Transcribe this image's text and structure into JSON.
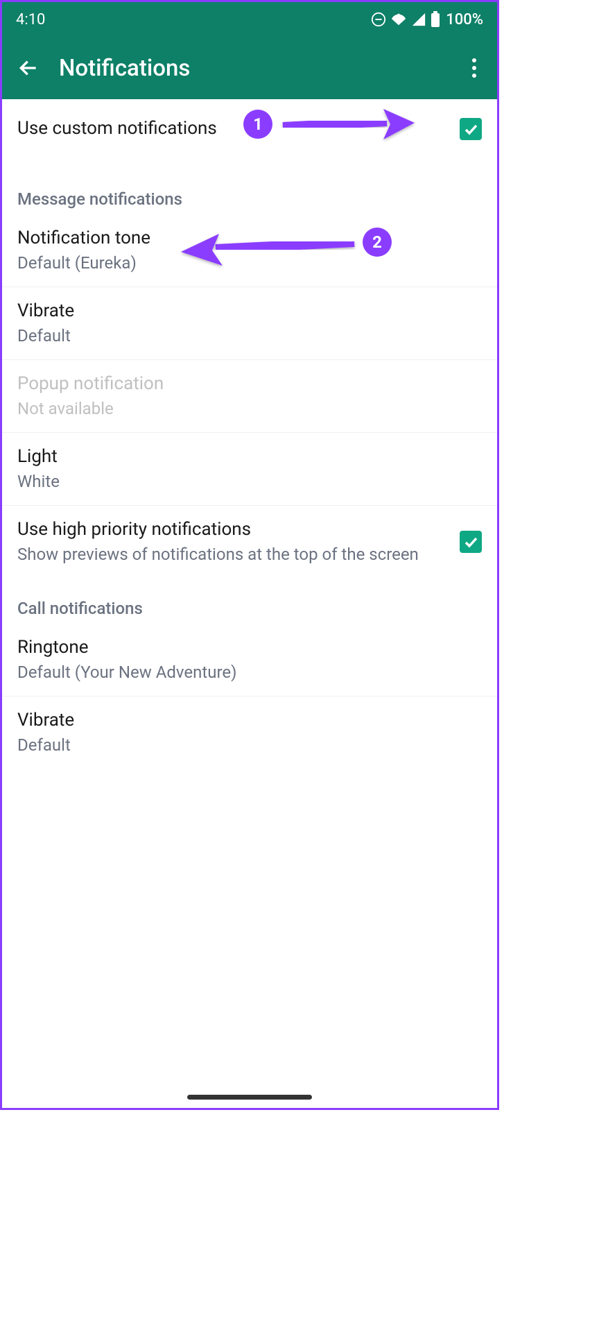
{
  "statusBar": {
    "time": "4:10",
    "batteryPercent": "100%"
  },
  "appBar": {
    "title": "Notifications"
  },
  "settings": {
    "customNotifications": {
      "label": "Use custom notifications",
      "checked": true
    },
    "sections": {
      "message": {
        "header": "Message notifications",
        "notificationTone": {
          "label": "Notification tone",
          "value": "Default (Eureka)"
        },
        "vibrate": {
          "label": "Vibrate",
          "value": "Default"
        },
        "popup": {
          "label": "Popup notification",
          "value": "Not available",
          "disabled": true
        },
        "light": {
          "label": "Light",
          "value": "White"
        },
        "highPriority": {
          "label": "Use high priority notifications",
          "subtitle": "Show previews of notifications at the top of the screen",
          "checked": true
        }
      },
      "call": {
        "header": "Call notifications",
        "ringtone": {
          "label": "Ringtone",
          "value": "Default (Your New Adventure)"
        },
        "vibrate": {
          "label": "Vibrate",
          "value": "Default"
        }
      }
    }
  },
  "annotations": {
    "badge1": "1",
    "badge2": "2"
  },
  "colors": {
    "primary": "#0d8067",
    "accent": "#0fa884",
    "annotation": "#8b3dff"
  }
}
